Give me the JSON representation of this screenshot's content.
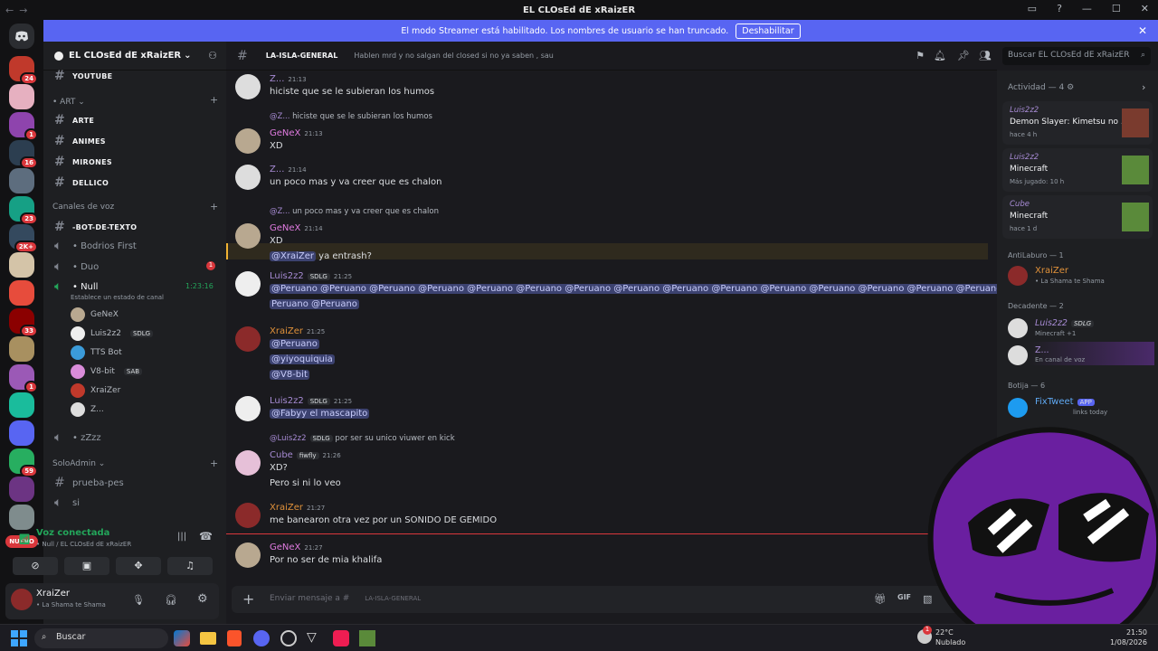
{
  "window": {
    "title": "EL CLOsEd dE xRaizER",
    "back": "←",
    "forward": "→"
  },
  "streamer": {
    "message": "El modo Streamer está habilitado. Los nombres de usuario se han truncado.",
    "button": "Deshabilitar"
  },
  "servers": [
    {
      "badge": "24",
      "color": "#c0392b"
    },
    {
      "badge": "",
      "color": "#e6b0c0"
    },
    {
      "badge": "1",
      "color": "#8e44ad"
    },
    {
      "badge": "16",
      "color": "#2c3e50"
    },
    {
      "badge": "",
      "color": "#5d6d7e"
    },
    {
      "badge": "23",
      "color": "#16a085"
    },
    {
      "badge": "2K+",
      "color": "#34495e"
    },
    {
      "badge": "",
      "color": "#d4c4a8"
    },
    {
      "badge": "",
      "color": "#e74c3c"
    },
    {
      "badge": "33",
      "color": "#8b0000"
    },
    {
      "badge": "",
      "color": "#a89060"
    },
    {
      "badge": "1",
      "color": "#9b59b6"
    },
    {
      "badge": "",
      "color": "#1abc9c"
    },
    {
      "badge": "",
      "color": "#5865f2"
    },
    {
      "badge": "59",
      "color": "#27ae60"
    },
    {
      "badge": "",
      "color": "#6c3483"
    },
    {
      "badge": "",
      "color": "#7f8c8d"
    }
  ],
  "new_label": "NUEVO",
  "guild": {
    "name": "EL CLOsEd dE xRaizER"
  },
  "channels": {
    "top": "YOUTUBE",
    "art_category": "• ART",
    "text": [
      "ARTE",
      "ANIMES",
      "MIRONES",
      "DELLICO"
    ],
    "voice_category": "Canales de voz",
    "voice": [
      "-BOT-DE-TEXTO",
      "• Bodrios First",
      "• Duo",
      "• Null"
    ],
    "duo_badge": "1",
    "null_time": "1:23:16",
    "null_status": "Establece un estado de canal",
    "members": [
      {
        "name": "GeNeX",
        "tag": "",
        "color": "#b8a890"
      },
      {
        "name": "Luis2z2",
        "tag": "SDLG",
        "color": "#eeeeee"
      },
      {
        "name": "TTS Bot",
        "tag": "",
        "color": "#3b9bd9"
      },
      {
        "name": "V8-bit",
        "tag": "SAB",
        "color": "#d98cd9"
      },
      {
        "name": "XraiZer",
        "tag": "",
        "color": "#c0392b"
      },
      {
        "name": "Z...",
        "tag": "",
        "color": "#ddd"
      }
    ],
    "zzzz": "• zZzz",
    "soloadmin": "SoloAdmin",
    "prueba": "prueba-pes",
    "si": "si"
  },
  "voice_panel": {
    "title": "Voz conectada",
    "sub": "• Null / EL CLOsEd dE xRaizER"
  },
  "user": {
    "name": "XraiZer",
    "status": "• La Shama te Shama"
  },
  "chat": {
    "channel": "LA-ISLA-GENERAL",
    "topic": "Hablen mrd y no salgan del closed si no ya saben , sau",
    "search_placeholder": "Buscar EL CLOsEd dE xRaizER",
    "composer_placeholder": "Enviar mensaje a #",
    "composer_channel": "LA-ISLA-GENERAL",
    "messages": [
      {
        "id": "m1",
        "author": "Z...",
        "color": "#a78bd4",
        "time": "21:13",
        "lines": [
          "hiciste que se le subieran los humos"
        ]
      },
      {
        "id": "m2",
        "reply": "hiciste que se le subieran los humos",
        "reply_author": "@Z...",
        "author": "GeNeX",
        "color": "#e07be0",
        "time": "21:13",
        "lines": [
          "XD"
        ]
      },
      {
        "id": "m3",
        "author": "Z...",
        "color": "#a78bd4",
        "time": "21:14",
        "lines": [
          "un poco mas y va creer que es chalon"
        ]
      },
      {
        "id": "m4",
        "reply": "un poco mas y va creer que es chalon",
        "reply_author": "@Z...",
        "author": "GeNeX",
        "color": "#e07be0",
        "time": "21:14",
        "lines": [
          "XD"
        ],
        "mention": "@XraiZer",
        "mention_rest": " ya entrash?"
      },
      {
        "id": "m5",
        "author": "Luis2z2",
        "color": "#a78bd4",
        "tag": "SDLG",
        "time": "21:25",
        "mentions_line1": "@Peruano @Peruano @Peruano @Peruano @Peruano @Peruano @Peruano @Peruano @Peruano @Peruano @Peruano @Peruano @Peruano @Peruano @Peruano @",
        "mentions_line2": "Peruano @Peruano"
      },
      {
        "id": "m6",
        "author": "XraiZer",
        "color": "#e0913a",
        "time": "21:25",
        "mention_list": [
          "@Peruano",
          "@yiyoquiquia",
          "@V8-bit"
        ]
      },
      {
        "id": "m7",
        "author": "Luis2z2",
        "color": "#a78bd4",
        "tag": "SDLG",
        "time": "21:25",
        "mention": "@Fabyy el mascapito"
      },
      {
        "id": "m8",
        "reply": "por ser su unico viuwer en kick",
        "reply_author": "@Luis2z2",
        "reply_tag": "SDLG",
        "author": "Cube",
        "color": "#a78bd4",
        "tag": "fiwfly",
        "time": "21:26",
        "lines": [
          "XD?",
          "Pero si ni lo veo"
        ]
      },
      {
        "id": "m9",
        "author": "XraiZer",
        "color": "#e0913a",
        "time": "21:27",
        "lines": [
          "me banearon otra vez por un SONIDO DE GEMIDO"
        ]
      },
      {
        "id": "m10",
        "author": "GeNeX",
        "color": "#e07be0",
        "time": "21:27",
        "lines": [
          "Por no ser de mia khalifa"
        ]
      }
    ]
  },
  "members_panel": {
    "activity_title": "Actividad — 4",
    "activities": [
      {
        "user": "Luis2z2",
        "game": "Demon Slayer: Kimetsu no ...",
        "meta": "hace 4 h",
        "art": "#7a3b2e"
      },
      {
        "user": "Luis2z2",
        "game": "Minecraft",
        "meta": "Más jugado: 10 h",
        "art": "#5a8a3a"
      },
      {
        "user": "Cube",
        "game": "Minecraft",
        "meta": "hace 1 d",
        "art": "#5a8a3a"
      }
    ],
    "antilaburo": "AntiLaburo — 1",
    "antilaburo_member": {
      "name": "XraiZer",
      "sub": "• La Shama te Shama"
    },
    "decadente": "Decadente — 2",
    "decadente_members": [
      {
        "name": "Luis2z2",
        "tag": "SDLG",
        "sub": "Minecraft +1"
      },
      {
        "name": "Z...",
        "sub": "En canal de voz"
      }
    ],
    "botija": "Botija — 6",
    "fixtweet": {
      "name": "FixTweet",
      "tag": "APP",
      "sub": "links today"
    }
  },
  "taskbar": {
    "search": "Buscar",
    "weather": "22°C",
    "weather_sub": "Nublado",
    "time": "21:50",
    "date": "1/08/2026",
    "notif": "1"
  }
}
